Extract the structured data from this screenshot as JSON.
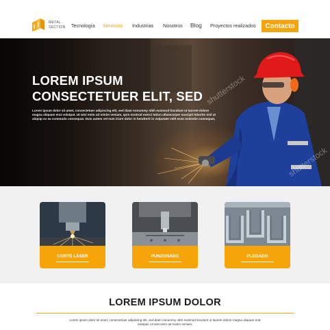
{
  "brand": {
    "line1": "METAL",
    "line2": "SECTION",
    "color": "#f5a50a"
  },
  "nav": {
    "items": [
      {
        "label": "Tecnología",
        "active": false
      },
      {
        "label": "Servicios",
        "active": true
      },
      {
        "label": "Industrias",
        "active": false
      },
      {
        "label": "Nosotros",
        "active": false
      },
      {
        "label": "Blog",
        "active": false
      },
      {
        "label": "Proyectos realizados",
        "active": false
      }
    ],
    "cta_label": "Contacto"
  },
  "hero": {
    "title_line1": "LOREM IPSUM",
    "title_line2": "CONSECTETUER  ELIT, SED",
    "body": "Lorem ipsum dolor sit amet, consectetuer adipiscing elit, sed diam nonummy nibh euismod tincidunt ut laoreet dolore magna aliquam erat volutpat. Ut wisi enim ad minim veniam, quis nostrud exerci tation ullamcorper suscipit lobortis nisl ut aliquip ex ea commodo consequat. Duis autem vel eum iriure dolor in hendrerit in vulputate velit esse molestie consequat,",
    "watermark": "shutterstock"
  },
  "services": [
    {
      "label": "CORTE LÁSER",
      "icon": "laser-cutting-image"
    },
    {
      "label": "PUNZONADO",
      "icon": "punching-machine-image"
    },
    {
      "label": "PLEGADO",
      "icon": "bent-steel-profiles-image"
    }
  ],
  "section": {
    "title": "LOREM IPSUM DOLOR",
    "text": "Lorem ipsum dolor sit amet, consectetuer adipiscing elit, sed diam nonummy nibh euismod tincidunt ut laoreet dolore magna aliquam erat volutpat. Ut wisi enim ad minim veniam,"
  }
}
